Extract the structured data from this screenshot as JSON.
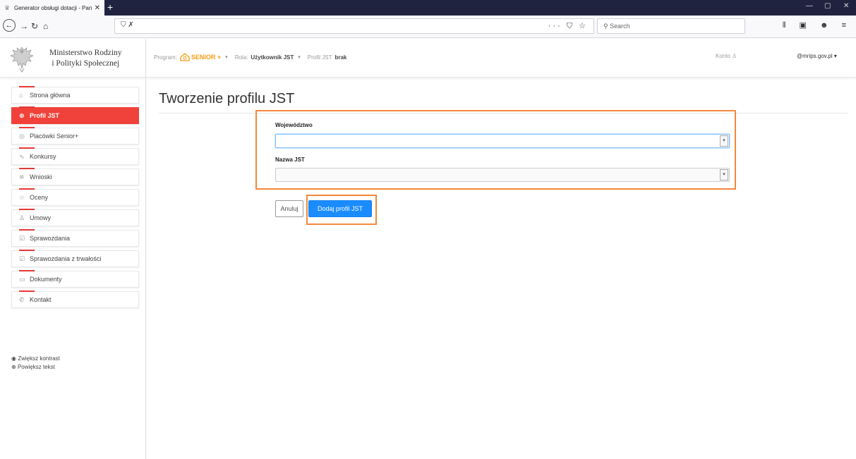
{
  "browser": {
    "tab_title": "Generator obsługi dotacji - Pan",
    "new_tab": "+",
    "search_placeholder": "Search",
    "url_more": "···"
  },
  "header": {
    "ministry_line1": "Ministerstwo Rodziny",
    "ministry_line2": "i Polityki Społecznej",
    "program_label": "Program:",
    "program_value": "SENIOR +",
    "role_label": "Rola:",
    "role_value": "Użytkownik JST",
    "profile_label": "Profil JST",
    "profile_value": "brak",
    "account_label": "Konto",
    "email": "@mrips.gov.pl"
  },
  "sidebar": {
    "items": [
      {
        "label": "Strona główna",
        "icon": "home-icon",
        "glyph": "⌂"
      },
      {
        "label": "Profil JST",
        "icon": "globe-icon",
        "glyph": "⊕",
        "active": true
      },
      {
        "label": "Placówki Senior+",
        "icon": "building-icon",
        "glyph": "◎"
      },
      {
        "label": "Konkursy",
        "icon": "pulse-icon",
        "glyph": "∿"
      },
      {
        "label": "Wnioski",
        "icon": "layers-icon",
        "glyph": "≋"
      },
      {
        "label": "Oceny",
        "icon": "star-icon",
        "glyph": "☆"
      },
      {
        "label": "Umowy",
        "icon": "award-icon",
        "glyph": "♙"
      },
      {
        "label": "Sprawozdania",
        "icon": "checkbox-icon",
        "glyph": "☑"
      },
      {
        "label": "Sprawozdania z trwałości",
        "icon": "checkbox-icon",
        "glyph": "☑"
      },
      {
        "label": "Dokumenty",
        "icon": "folder-icon",
        "glyph": "▭"
      },
      {
        "label": "Kontakt",
        "icon": "phone-icon",
        "glyph": "✆"
      }
    ],
    "contrast": "Zwiększ kontrast",
    "enlarge": "Powiększ tekst"
  },
  "main": {
    "title": "Tworzenie profilu JST",
    "field_voivodeship_label": "Województwo",
    "field_voivodeship_value": "",
    "field_jst_label": "Nazwa JST",
    "field_jst_value": "",
    "cancel_label": "Anuluj",
    "submit_label": "Dodaj profil JST"
  },
  "colors": {
    "accent_red": "#f0423a",
    "highlight_orange": "#f5883a",
    "primary_blue": "#1a8cff",
    "senior_orange": "#f39c12"
  }
}
